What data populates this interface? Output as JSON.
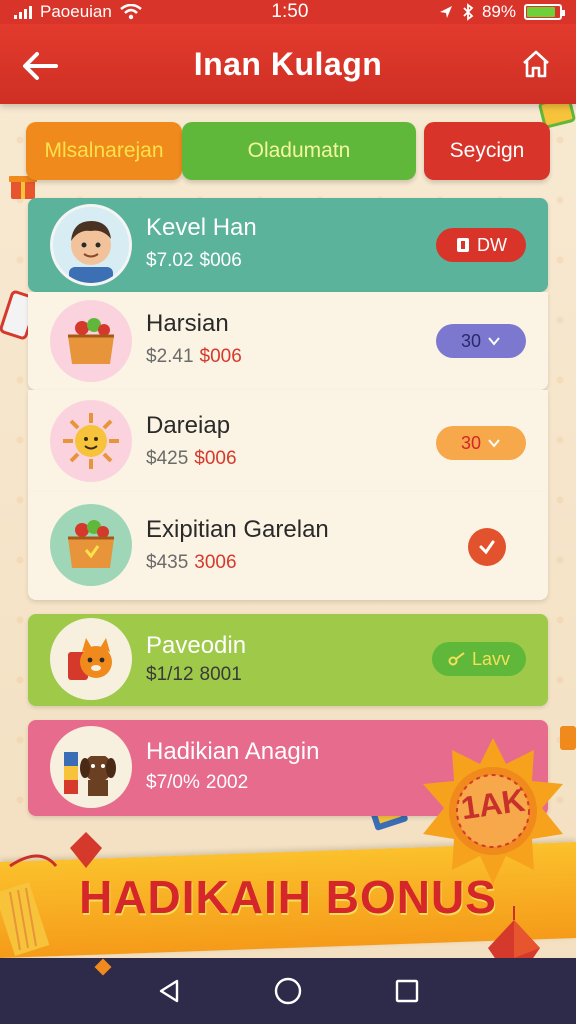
{
  "status_bar": {
    "carrier": "Paoeuian",
    "time": "1:50",
    "battery": "89%",
    "battery_level": 0.89,
    "icons": [
      "signal-icon",
      "wifi-icon",
      "location-icon",
      "bluetooth-icon",
      "battery-icon"
    ]
  },
  "header": {
    "title": "Inan Kulagn",
    "back_icon": "back-arrow-icon",
    "home_icon": "home-icon"
  },
  "tabs": [
    {
      "label": "Mlsalnarejan",
      "color": "#f08a1c"
    },
    {
      "label": "Oladumatn",
      "color": "#5fb83a"
    },
    {
      "label": "Seycign",
      "color": "#d8342a"
    }
  ],
  "items": [
    {
      "name": "Kevel Han",
      "price_1": "$7.02",
      "price_2": "$006",
      "action_label": "DW",
      "avatar_icon": "boy-avatar-icon",
      "color": "#5ab39a"
    },
    {
      "name": "Harsian",
      "price_1": "$2.41",
      "price_2": "$006",
      "action_label": "30",
      "avatar_icon": "vegetable-basket-icon",
      "color": "#fbf4e4"
    },
    {
      "name": "Dareiap",
      "price_1": "$425",
      "price_2": "$006",
      "action_label": "30",
      "avatar_icon": "sun-mascot-icon",
      "color": "#fbf4e4"
    },
    {
      "name": "Exipitian Garelan",
      "price_1": "$435",
      "price_2": "3006",
      "action_label": "",
      "avatar_icon": "gift-basket-icon",
      "color": "#fbf4e4"
    },
    {
      "name": "Paveodin",
      "price_1": "$1/12",
      "price_2": "8001",
      "action_label": "Lavv",
      "avatar_icon": "fox-mascot-icon",
      "color": "#9fca49"
    },
    {
      "name": "Hadikian Anagin",
      "price_1": "$7/0%",
      "price_2": "2002",
      "action_label": "",
      "avatar_icon": "dog-mascot-icon",
      "color": "#e76b8d"
    }
  ],
  "bonus": {
    "banner_text": "HADIKAIH BONUS",
    "badge_text": "1AK"
  },
  "nav": {
    "icons": [
      "back-triangle-icon",
      "home-circle-icon",
      "recents-square-icon"
    ]
  }
}
